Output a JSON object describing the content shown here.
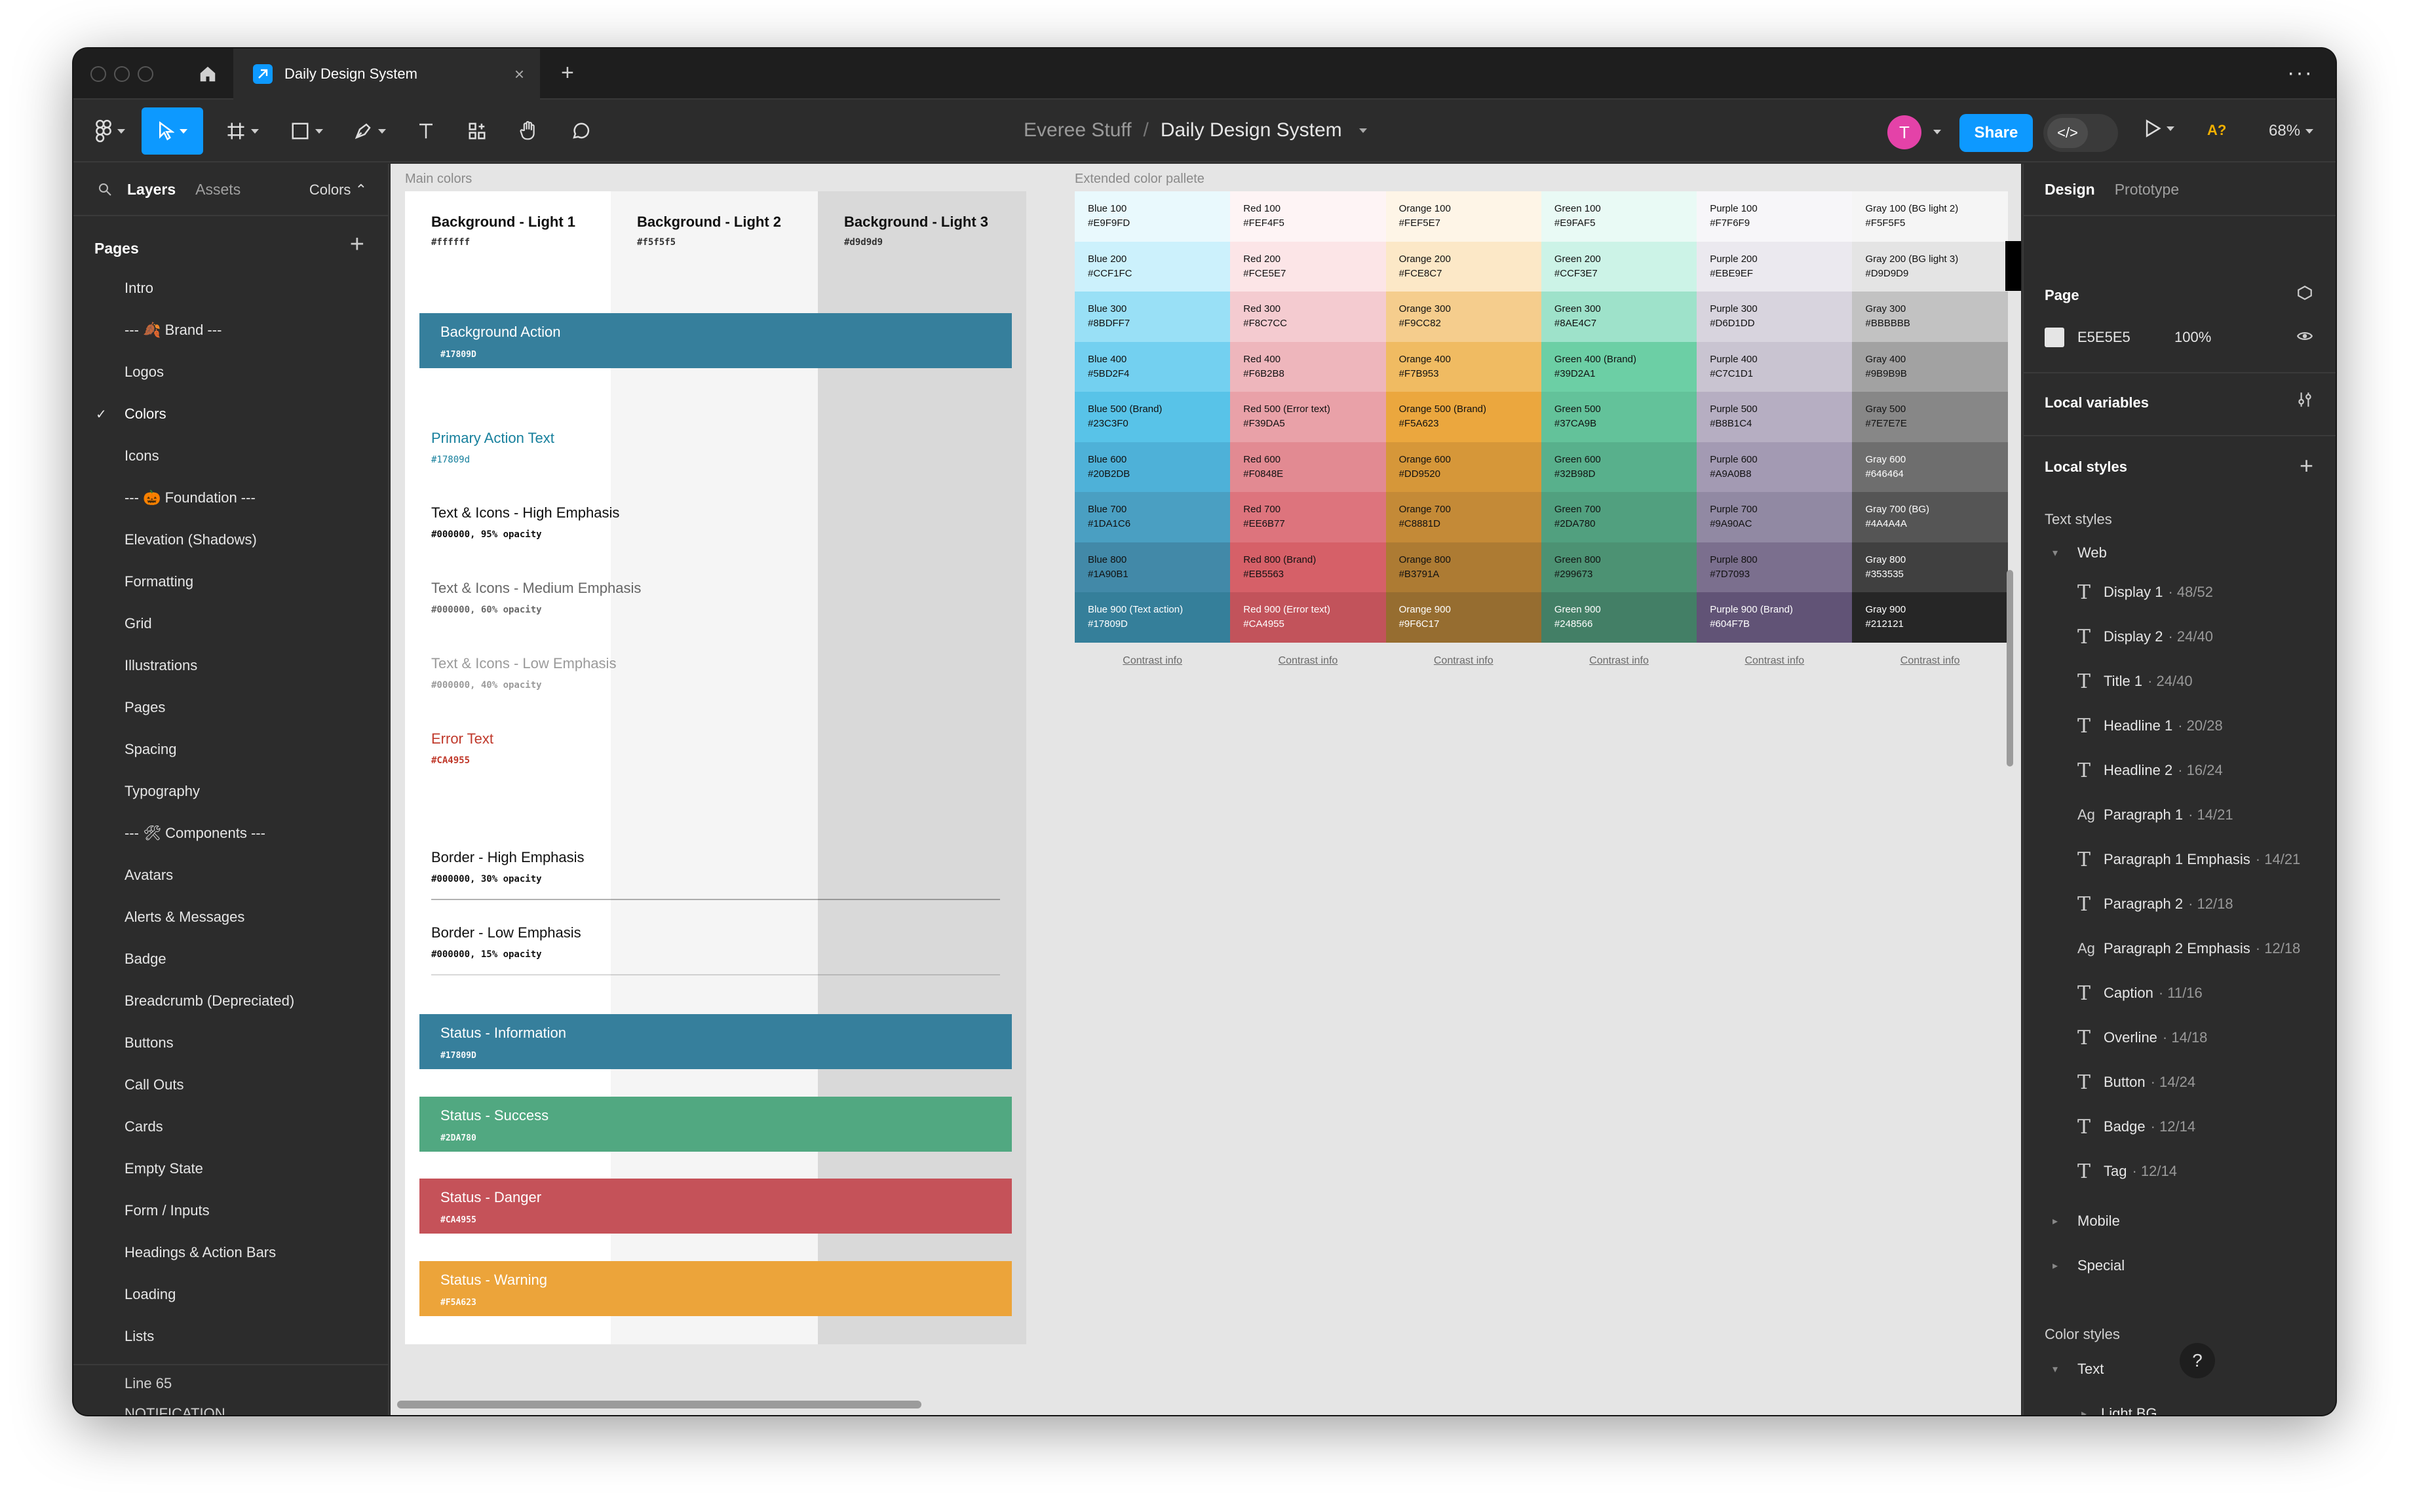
{
  "window": {
    "tab_title": "Daily Design System"
  },
  "toolbar": {
    "project": "Everee Stuff",
    "separator": "/",
    "file": "Daily Design System",
    "avatar_initial": "T",
    "share_label": "Share",
    "dev_mode_label": "</>",
    "a11y_label": "A?",
    "zoom": "68%"
  },
  "left_panel": {
    "tab_layers": "Layers",
    "tab_assets": "Assets",
    "colors_dropdown": "Colors",
    "pages_header": "Pages",
    "pages": [
      "Intro",
      "--- 🍂 Brand ---",
      "Logos",
      "Colors",
      "Icons",
      "--- 🎃 Foundation ---",
      "Elevation (Shadows)",
      "Formatting",
      "Grid",
      "Illustrations",
      "Pages",
      "Spacing",
      "Typography",
      "--- 🛠 Components ---",
      "Avatars",
      "Alerts & Messages",
      "Badge",
      "Breadcrumb (Depreciated)",
      "Buttons",
      "Call Outs",
      "Cards",
      "Empty State",
      "Form / Inputs",
      "Headings & Action Bars",
      "Loading",
      "Lists"
    ],
    "layers": [
      "Line 65",
      "NOTIFICATION"
    ]
  },
  "canvas": {
    "main_label": "Main colors",
    "ext_label": "Extended color pallete",
    "backgrounds": [
      {
        "name": "Background - Light 1",
        "hex": "#ffffff",
        "color": "#ffffff"
      },
      {
        "name": "Background - Light 2",
        "hex": "#f5f5f5",
        "color": "#f5f5f5"
      },
      {
        "name": "Background - Light 3",
        "hex": "#d9d9d9",
        "color": "#d9d9d9"
      }
    ],
    "action": {
      "name": "Background Action",
      "hex": "#17809D",
      "color": "#367f9c"
    },
    "primary_text": {
      "name": "Primary Action Text",
      "hex": "#17809d",
      "color": "#17809d"
    },
    "high_emphasis": {
      "name": "Text & Icons - High Emphasis",
      "hex": "#000000, 95% opacity"
    },
    "medium_emphasis": {
      "name": "Text & Icons - Medium Emphasis",
      "hex": "#000000, 60% opacity"
    },
    "low_emphasis": {
      "name": "Text & Icons - Low Emphasis",
      "hex": "#000000, 40% opacity"
    },
    "error_text": {
      "name": "Error Text",
      "hex": "#CA4955",
      "color": "#c0392b"
    },
    "border_high": {
      "name": "Border - High Emphasis",
      "hex": "#000000, 30% opacity"
    },
    "border_low": {
      "name": "Border - Low Emphasis",
      "hex": "#000000, 15% opacity"
    },
    "status": [
      {
        "name": "Status - Information",
        "hex": "#17809D",
        "color": "#367f9c"
      },
      {
        "name": "Status - Success",
        "hex": "#2DA780",
        "color": "#51a881"
      },
      {
        "name": "Status - Danger",
        "hex": "#CA4955",
        "color": "#c55259"
      },
      {
        "name": "Status - Warning",
        "hex": "#F5A623",
        "color": "#eca43a"
      }
    ],
    "contrast_label": "Contrast info",
    "palette": [
      [
        {
          "name": "Blue 100",
          "hex": "#E9F9FD",
          "color": "#e9f9fd",
          "fg": "#111"
        },
        {
          "name": "Red 100",
          "hex": "#FEF4F5",
          "color": "#fef4f5",
          "fg": "#111"
        },
        {
          "name": "Orange 100",
          "hex": "#FEF5E7",
          "color": "#fef5e7",
          "fg": "#111"
        },
        {
          "name": "Green 100",
          "hex": "#E9FAF5",
          "color": "#e9faf5",
          "fg": "#111"
        },
        {
          "name": "Purple 100",
          "hex": "#F7F6F9",
          "color": "#f7f6f9",
          "fg": "#111"
        },
        {
          "name": "Gray 100 (BG light 2)",
          "hex": "#F5F5F5",
          "color": "#f5f5f5",
          "fg": "#111"
        }
      ],
      [
        {
          "name": "Blue 200",
          "hex": "#CCF1FC",
          "color": "#ccf1fc",
          "fg": "#111"
        },
        {
          "name": "Red 200",
          "hex": "#FCE5E7",
          "color": "#fce5e7",
          "fg": "#111"
        },
        {
          "name": "Orange 200",
          "hex": "#FCE8C7",
          "color": "#fce8c7",
          "fg": "#111"
        },
        {
          "name": "Green 200",
          "hex": "#CCF3E7",
          "color": "#ccf3e7",
          "fg": "#111"
        },
        {
          "name": "Purple 200",
          "hex": "#EBE9EF",
          "color": "#ebe9ef",
          "fg": "#111"
        },
        {
          "name": "Gray 200 (BG light 3)",
          "hex": "#D9D9D9",
          "color": "#e4e4e4",
          "fg": "#111"
        }
      ],
      [
        {
          "name": "Blue 300",
          "hex": "#8BDFF7",
          "color": "#99e0f6",
          "fg": "#111"
        },
        {
          "name": "Red 300",
          "hex": "#F8C7CC",
          "color": "#f4cbd0",
          "fg": "#111"
        },
        {
          "name": "Orange 300",
          "hex": "#F9CC82",
          "color": "#f5cd8d",
          "fg": "#111"
        },
        {
          "name": "Green 300",
          "hex": "#8AE4C7",
          "color": "#9ee2ca",
          "fg": "#111"
        },
        {
          "name": "Purple 300",
          "hex": "#D6D1DD",
          "color": "#d8d4de",
          "fg": "#111"
        },
        {
          "name": "Gray 300",
          "hex": "#BBBBBB",
          "color": "#c2c2c2",
          "fg": "#111"
        }
      ],
      [
        {
          "name": "Blue 400",
          "hex": "#5BD2F4",
          "color": "#73d0f0",
          "fg": "#111"
        },
        {
          "name": "Red 400",
          "hex": "#F6B2B8",
          "color": "#eeb6bc",
          "fg": "#111"
        },
        {
          "name": "Orange 400",
          "hex": "#F7B953",
          "color": "#f0bb62",
          "fg": "#111"
        },
        {
          "name": "Green 400 (Brand)",
          "hex": "#39D2A1",
          "color": "#6ccfa5",
          "fg": "#111"
        },
        {
          "name": "Purple 400",
          "hex": "#C7C1D1",
          "color": "#c9c4d1",
          "fg": "#111"
        },
        {
          "name": "Gray 400",
          "hex": "#9B9B9B",
          "color": "#a2a2a2",
          "fg": "#111"
        }
      ],
      [
        {
          "name": "Blue 500 (Brand)",
          "hex": "#23C3F0",
          "color": "#58c3e8",
          "fg": "#111"
        },
        {
          "name": "Red 500 (Error text)",
          "hex": "#F39DA5",
          "color": "#e9a1a8",
          "fg": "#111"
        },
        {
          "name": "Orange 500 (Brand)",
          "hex": "#F5A623",
          "color": "#eba73e",
          "fg": "#111"
        },
        {
          "name": "Green 500",
          "hex": "#37CA9B",
          "color": "#63c29a",
          "fg": "#111"
        },
        {
          "name": "Purple 500",
          "hex": "#B8B1C4",
          "color": "#b6aec2",
          "fg": "#111"
        },
        {
          "name": "Gray 500",
          "hex": "#7E7E7E",
          "color": "#878787",
          "fg": "#111"
        }
      ],
      [
        {
          "name": "Blue 600",
          "hex": "#20B2DB",
          "color": "#4eb1d8",
          "fg": "#111"
        },
        {
          "name": "Red 600",
          "hex": "#F0848E",
          "color": "#e28a92",
          "fg": "#111"
        },
        {
          "name": "Orange 600",
          "hex": "#DD9520",
          "color": "#d69739",
          "fg": "#111"
        },
        {
          "name": "Green 600",
          "hex": "#32B98D",
          "color": "#58b08c",
          "fg": "#111"
        },
        {
          "name": "Purple 600",
          "hex": "#A9A0B8",
          "color": "#a39ab3",
          "fg": "#111"
        },
        {
          "name": "Gray 600",
          "hex": "#646464",
          "color": "#6e6e6e",
          "fg": "#fff"
        }
      ],
      [
        {
          "name": "Blue 700",
          "hex": "#1DA1C6",
          "color": "#4a9fc2",
          "fg": "#111"
        },
        {
          "name": "Red 700",
          "hex": "#EE6B77",
          "color": "#dd747d",
          "fg": "#111"
        },
        {
          "name": "Orange 700",
          "hex": "#C8881D",
          "color": "#c48a37",
          "fg": "#111"
        },
        {
          "name": "Green 700",
          "hex": "#2DA780",
          "color": "#51a07f",
          "fg": "#111"
        },
        {
          "name": "Purple 700",
          "hex": "#9A90AC",
          "color": "#9189a3",
          "fg": "#111"
        },
        {
          "name": "Gray 700 (BG)",
          "hex": "#4A4A4A",
          "color": "#555555",
          "fg": "#fff"
        }
      ],
      [
        {
          "name": "Blue 800",
          "hex": "#1A90B1",
          "color": "#4289a8",
          "fg": "#111"
        },
        {
          "name": "Red 800 (Brand)",
          "hex": "#EB5563",
          "color": "#d66068",
          "fg": "#111"
        },
        {
          "name": "Orange 800",
          "hex": "#B3791A",
          "color": "#ad7b33",
          "fg": "#111"
        },
        {
          "name": "Green 800",
          "hex": "#299673",
          "color": "#4c9273",
          "fg": "#111"
        },
        {
          "name": "Purple 800",
          "hex": "#7D7093",
          "color": "#7b6f8e",
          "fg": "#111"
        },
        {
          "name": "Gray 800",
          "hex": "#353535",
          "color": "#404040",
          "fg": "#fff"
        }
      ],
      [
        {
          "name": "Blue 900 (Text action)",
          "hex": "#17809D",
          "color": "#357f9a",
          "fg": "#fff"
        },
        {
          "name": "Red 900 (Error text)",
          "hex": "#CA4955",
          "color": "#c2535b",
          "fg": "#fff"
        },
        {
          "name": "Orange 900",
          "hex": "#9F6C17",
          "color": "#966d30",
          "fg": "#fff"
        },
        {
          "name": "Green 900",
          "hex": "#248566",
          "color": "#437f66",
          "fg": "#fff"
        },
        {
          "name": "Purple 900 (Brand)",
          "hex": "#604F7B",
          "color": "#615376",
          "fg": "#fff"
        },
        {
          "name": "Gray 900",
          "hex": "#212121",
          "color": "#262626",
          "fg": "#fff"
        }
      ]
    ]
  },
  "right_panel": {
    "tab_design": "Design",
    "tab_prototype": "Prototype",
    "page_header": "Page",
    "page_color": "E5E5E5",
    "page_opacity": "100%",
    "local_variables": "Local variables",
    "local_styles": "Local styles",
    "text_styles": "Text styles",
    "group_web": "Web",
    "text_style_list": [
      {
        "icon": "T",
        "name": "Display 1",
        "meta": "· 48/52"
      },
      {
        "icon": "T",
        "name": "Display 2",
        "meta": "· 24/40"
      },
      {
        "icon": "T",
        "name": "Title 1",
        "meta": "· 24/40"
      },
      {
        "icon": "T",
        "name": "Headline 1",
        "meta": "· 20/28"
      },
      {
        "icon": "T",
        "name": "Headline 2",
        "meta": "· 16/24"
      },
      {
        "icon": "Ag",
        "name": "Paragraph 1",
        "meta": "· 14/21"
      },
      {
        "icon": "T",
        "name": "Paragraph 1 Emphasis",
        "meta": "· 14/21"
      },
      {
        "icon": "T",
        "name": "Paragraph 2",
        "meta": "· 12/18"
      },
      {
        "icon": "Ag",
        "name": "Paragraph 2 Emphasis",
        "meta": "· 12/18"
      },
      {
        "icon": "T",
        "name": "Caption",
        "meta": "· 11/16"
      },
      {
        "icon": "T",
        "name": "Overline",
        "meta": "· 14/18"
      },
      {
        "icon": "T",
        "name": "Button",
        "meta": "· 14/24"
      },
      {
        "icon": "T",
        "name": "Badge",
        "meta": "· 12/14"
      },
      {
        "icon": "T",
        "name": "Tag",
        "meta": "· 12/14"
      }
    ],
    "group_mobile": "Mobile",
    "group_special": "Special",
    "color_styles": "Color styles",
    "group_text": "Text",
    "group_light_bg": "Light BG",
    "help": "?"
  }
}
